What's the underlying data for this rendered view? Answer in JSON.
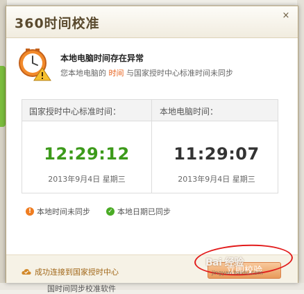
{
  "window": {
    "title": "360时间校准",
    "close_glyph": "×"
  },
  "alert": {
    "headline": "本地电脑时间存在异常",
    "sub_prefix": "您本地电脑的",
    "sub_highlight": "时间",
    "sub_suffix": "与国家授时中心标准时间未同步"
  },
  "time_panel": {
    "standard": {
      "label": "国家授时中心标准时间：",
      "time": "12:29:12",
      "date": "2013年9月4日  星期三"
    },
    "local": {
      "label": "本地电脑时间：",
      "time": "11:29:07",
      "date": "2013年9月4日  星期三"
    }
  },
  "status": {
    "time_status": "本地时间未同步",
    "date_status": "本地日期已同步"
  },
  "footer": {
    "connection_msg": "成功连接到国家授时中心",
    "calibrate_label": "立即校验"
  },
  "watermark": {
    "brand": "Bai 经验",
    "domain": "jingyan.baidu.com"
  },
  "background": {
    "bottom_text": "国时间同步校准软件"
  },
  "colors": {
    "std_time": "#3c9a1a",
    "highlight": "#e7601a",
    "warn": "#ef7d21",
    "ok": "#4aab25",
    "footer_text": "#a16718"
  }
}
